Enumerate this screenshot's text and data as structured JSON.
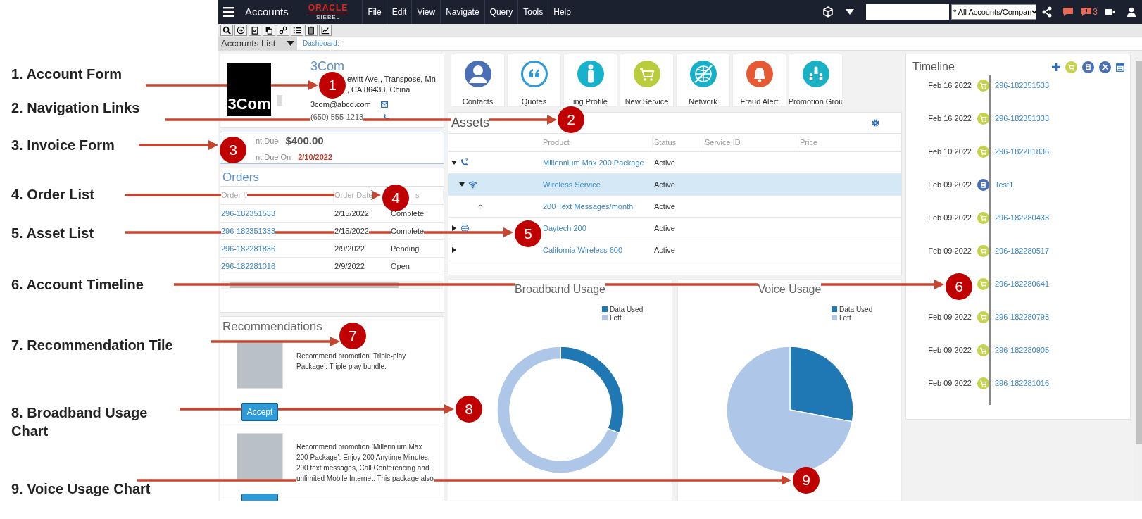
{
  "annotations": [
    {
      "number": "1",
      "label": "1. Account Form"
    },
    {
      "number": "2",
      "label": "2. Navigation Links"
    },
    {
      "number": "3",
      "label": "3. Invoice Form"
    },
    {
      "number": "4",
      "label": "4. Order List"
    },
    {
      "number": "5",
      "label": "5. Asset List"
    },
    {
      "number": "6",
      "label": "6. Account Timeline"
    },
    {
      "number": "7",
      "label": "7. Recommendation Tile"
    },
    {
      "number": "8",
      "label": "8. Broadband Usage Chart"
    },
    {
      "number": "9",
      "label": "9. Voice Usage Chart"
    }
  ],
  "app_bar": {
    "title": "Accounts",
    "logo_top": "ORACLE",
    "logo_bottom": "SIEBEL",
    "menus": [
      "File",
      "Edit",
      "View",
      "Navigate",
      "Query",
      "Tools",
      "Help"
    ],
    "scope": "* All Accounts/Compan",
    "notification_count": "3"
  },
  "view_bar": {
    "view": "Accounts List",
    "link": "Dashboard:"
  },
  "account": {
    "logo_text": "3Com",
    "name": "3Com",
    "address_line_1": "ewitt Ave., Transpose, Mn",
    "address_line_2": ", CA 86433, China",
    "email": "3com@abcd.com",
    "phone": "(650) 555-1213"
  },
  "invoice": {
    "amount_label": "nt Due",
    "amount": "$400.00",
    "due_label": "nt Due On",
    "due_date": "2/10/2022"
  },
  "orders": {
    "title": "Orders",
    "columns": [
      "Order #",
      "Order Date",
      "s"
    ],
    "rows": [
      [
        "296-182351533",
        "2/15/2022",
        "Complete"
      ],
      [
        "296-182351333",
        "2/15/2022",
        "Complete"
      ],
      [
        "296-182281836",
        "2/9/2022",
        "Pending"
      ],
      [
        "296-182281016",
        "2/9/2022",
        "Open"
      ]
    ]
  },
  "navigation_links": [
    {
      "label": "Contacts",
      "kind": "contacts",
      "color": "#4a6fb5"
    },
    {
      "label": "Quotes",
      "kind": "quotes",
      "color": "#2f9ad8"
    },
    {
      "label": "ing Profile",
      "kind": "profile",
      "color": "#17b3cc"
    },
    {
      "label": "New Service",
      "kind": "service",
      "color": "#b9cc3c"
    },
    {
      "label": "Network",
      "kind": "network",
      "color": "#16b0c8"
    },
    {
      "label": "Fraud Alert",
      "kind": "alert",
      "color": "#e55a35"
    },
    {
      "label": "Promotion Grou",
      "kind": "promotion",
      "color": "#19b2c4"
    }
  ],
  "assets": {
    "title": "Assets",
    "columns": [
      "Product",
      "Status",
      "Service ID",
      "Price"
    ],
    "rows": [
      {
        "product": "Millennium Max 200 Package",
        "status": "Active",
        "kind": "voice",
        "expanded": true,
        "selected": false,
        "children": [
          {
            "product": "Wireless Service",
            "status": "Active",
            "kind": "wireless",
            "expanded": true,
            "selected": true,
            "children": [
              {
                "product": "200 Text Messages/month",
                "status": "Active",
                "kind": "feature",
                "selected": false
              }
            ]
          }
        ]
      },
      {
        "product": "Daytech 200",
        "status": "Active",
        "kind": "broadband",
        "expanded": false,
        "selected": false
      },
      {
        "product": "California Wireless 600",
        "status": "Active",
        "kind": "plan",
        "expanded": false,
        "selected": false
      }
    ]
  },
  "recommendations": {
    "title": "Recommendations",
    "items": [
      {
        "text": "Recommend promotion ‘Triple-play Package’: Triple play bundle.",
        "button": "Accept"
      },
      {
        "text": "Recommend promotion ‘Millennium Max 200 Package’: Enjoy 200 Anytime Minutes, 200 text messages, Call Conferencing and unlimited Mobile Internet. This package also"
      }
    ]
  },
  "charts": [
    {
      "title": "Broadband Usage",
      "kind": "donut",
      "legend": [
        {
          "label": "Data Used",
          "color": "#1f77b4"
        },
        {
          "label": "Left",
          "color": "#aec7e8"
        }
      ]
    },
    {
      "title": "Voice Usage",
      "kind": "pie",
      "legend": [
        {
          "label": "Data Used",
          "color": "#1f77b4"
        },
        {
          "label": "Left",
          "color": "#aec7e8"
        }
      ]
    }
  ],
  "timeline": {
    "title": "Timeline",
    "entries": [
      {
        "date": "Feb 16 2022",
        "label": "296-182351533",
        "kind": "order"
      },
      {
        "date": "Feb 16 2022",
        "label": "296-182351333",
        "kind": "order"
      },
      {
        "date": "Feb 10 2022",
        "label": "296-182281836",
        "kind": "order"
      },
      {
        "date": "Feb 09 2022",
        "label": "Test1",
        "kind": "activity"
      },
      {
        "date": "Feb 09 2022",
        "label": "296-182280433",
        "kind": "order"
      },
      {
        "date": "Feb 09 2022",
        "label": "296-182280517",
        "kind": "order"
      },
      {
        "label": "296-182280641",
        "kind": "order"
      },
      {
        "date": "Feb 09 2022",
        "label": "296-182280793",
        "kind": "order"
      },
      {
        "date": "Feb 09 2022",
        "label": "296-182280905",
        "kind": "order"
      },
      {
        "date": "Feb 09 2022",
        "label": "296-182281016",
        "kind": "order"
      }
    ]
  }
}
